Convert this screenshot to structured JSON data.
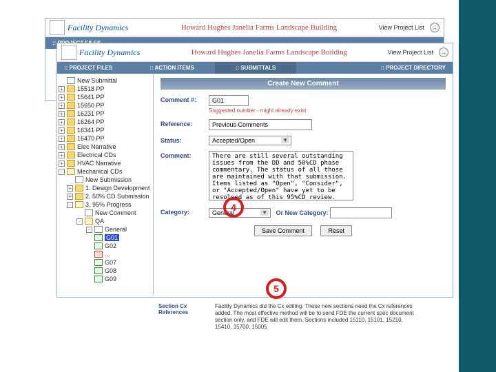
{
  "logo_name": "Facility Dynamics",
  "title": "Howard Hughes Janelia Farms Landscape Building",
  "view_link": "View Project List",
  "tabs": {
    "files": ":: PROJECT FILES",
    "actions": ":: ACTION ITEMS",
    "submittals": ":: SUBMITTALS",
    "directory": ":: PROJECT DIRECTORY"
  },
  "tree": [
    {
      "kind": "file",
      "label": "New Submittal",
      "toggle": ""
    },
    {
      "kind": "folder",
      "label": "15518 PP",
      "toggle": "+"
    },
    {
      "kind": "folder",
      "label": "15641 PP",
      "toggle": "+"
    },
    {
      "kind": "folder",
      "label": "15650 PP",
      "toggle": "+"
    },
    {
      "kind": "folder",
      "label": "16231 PP",
      "toggle": "+"
    },
    {
      "kind": "folder",
      "label": "16264 PP",
      "toggle": "+"
    },
    {
      "kind": "folder",
      "label": "16341 PP",
      "toggle": "+"
    },
    {
      "kind": "folder",
      "label": "16470 PP",
      "toggle": "+"
    },
    {
      "kind": "folder",
      "label": "Elec Narrative",
      "toggle": "+"
    },
    {
      "kind": "folder",
      "label": "Electrical CDs",
      "toggle": "+"
    },
    {
      "kind": "folder",
      "label": "HVAC Narrative",
      "toggle": "+"
    },
    {
      "kind": "folder-open",
      "label": "Mechanical CDs",
      "toggle": "-"
    }
  ],
  "tree_sub": [
    {
      "kind": "file",
      "label": "New Submission",
      "toggle": ""
    },
    {
      "kind": "folder",
      "label": "1. Design Development",
      "toggle": "+"
    },
    {
      "kind": "folder",
      "label": "2. 50% CD Submission",
      "toggle": "+"
    },
    {
      "kind": "folder-open",
      "label": "3. 95% Progress",
      "toggle": "-"
    }
  ],
  "tree_sub2": [
    {
      "kind": "file",
      "label": "New Comment",
      "toggle": ""
    },
    {
      "kind": "folder-open",
      "label": "QA",
      "toggle": "-"
    }
  ],
  "tree_sub3": [
    {
      "kind": "file",
      "label": "General",
      "toggle": "-"
    },
    {
      "kind": "file-green",
      "label": "G01",
      "selected": true
    },
    {
      "kind": "file-green",
      "label": "G02",
      "selected": false
    },
    {
      "kind": "file-red",
      "label": "...",
      "selected": false
    },
    {
      "kind": "file-green",
      "label": "G07",
      "selected": false
    },
    {
      "kind": "file-green",
      "label": "G08",
      "selected": false
    },
    {
      "kind": "file-green",
      "label": "G09",
      "selected": false
    }
  ],
  "form": {
    "panel_title": "Create New Comment",
    "labels": {
      "comment_no": "Comment #:",
      "reference": "Reference:",
      "status": "Status:",
      "comment": "Comment:",
      "category": "Category:",
      "or_new": "Or New Category:"
    },
    "comment_no_value": "G01",
    "hint": "Suggested number - might already exist",
    "reference_value": "Previous Comments",
    "status_value": "Accepted/Open",
    "comment_text": "There are still several outstanding issues from the DD and 50%CD phase commentary. The status of all those are maintained with that submission. Items listed as \"Open\", \"Consider\", or \"Accepted/Open\" have yet to be resolved as of this 95%CD review. The \"Accepted/Open\" items are",
    "category_value": "General",
    "new_category_value": "",
    "buttons": {
      "save": "Save Comment",
      "reset": "Reset"
    }
  },
  "below": {
    "label": "Section Cx References",
    "text": "Facility Dynamics did the Cx editing. These new sections need the Cx references added. The most effective method will be to send FDE the current spec document section only, and FDE will edit them. Sections included 15110, 15101, 15210, 15410, 15700, 15005"
  },
  "markers": {
    "m4": "4",
    "m5": "5"
  }
}
